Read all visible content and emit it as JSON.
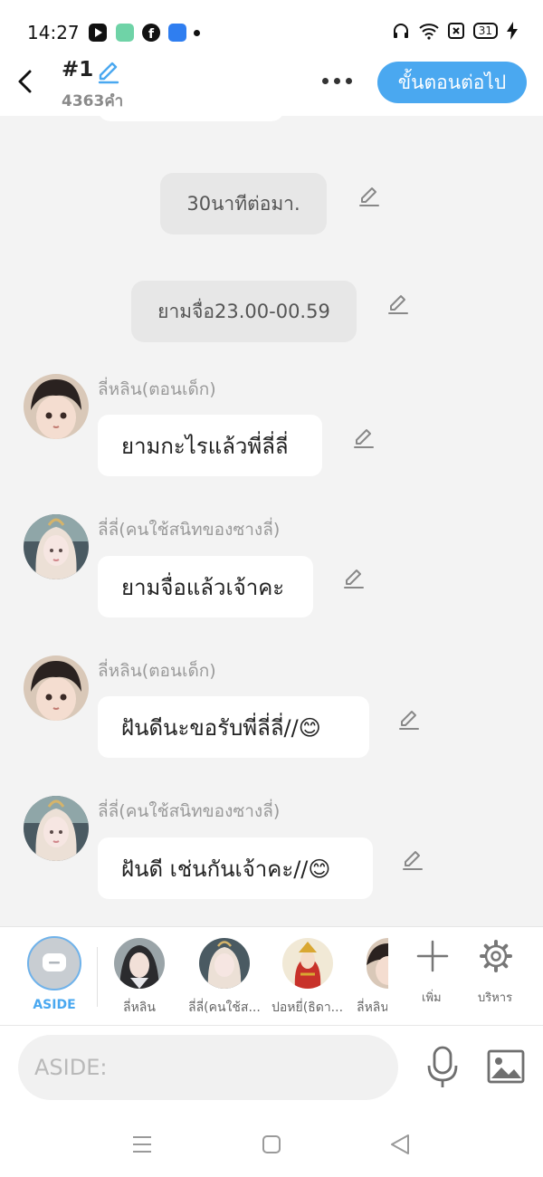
{
  "status_bar": {
    "time": "14:27",
    "battery": "31"
  },
  "header": {
    "title": "#1",
    "word_count": "4363คำ",
    "next_label": "ขั้นตอนต่อไป"
  },
  "chat": {
    "narrations": [
      "30นาทีต่อมา.",
      "ยามจื่อ23.00-00.59"
    ],
    "messages": [
      {
        "speaker": "ลี่หลิน(ตอนเด็ก)",
        "text": "ยามกะไรแล้วพี่ลี่ลี่"
      },
      {
        "speaker": "ลี่ลี่(คนใช้สนิทของซางลี่)",
        "text": "ยามจื่อแล้วเจ้าคะ"
      },
      {
        "speaker": "ลี่หลิน(ตอนเด็ก)",
        "text": "ฝันดีนะขอรับพี่ลี่ลี่//😊"
      },
      {
        "speaker": "ลี่ลี่(คนใช้สนิทของซางลี่)",
        "text": "ฝันดี เช่นกันเจ้าคะ//😊"
      }
    ]
  },
  "characters": {
    "aside_label": "ASIDE",
    "items": [
      "ลี่หลิน",
      "ลี่ลี่(คนใช้ส...",
      "ปอหยี่(ธิดา...",
      "ลี่หลิน"
    ],
    "add_label": "เพิ่ม",
    "manage_label": "บริหาร"
  },
  "input": {
    "placeholder": "ASIDE:"
  },
  "icons": {
    "back": "chevron-left-icon",
    "edit": "pencil-icon",
    "more": "ellipsis-icon",
    "aside": "chat-bubble-icon",
    "add": "plus-icon",
    "manage": "gear-icon",
    "mic": "microphone-icon",
    "image": "image-icon"
  },
  "colors": {
    "accent": "#4aa8f0",
    "background": "#f3f3f3",
    "narration_bg": "#e7e7e7"
  }
}
